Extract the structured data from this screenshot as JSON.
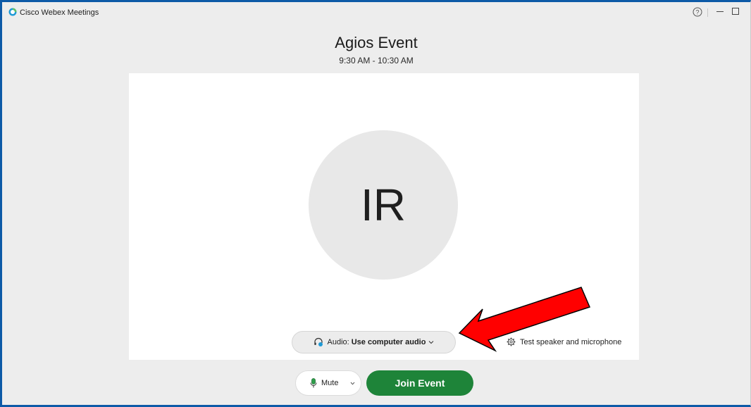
{
  "window": {
    "app_title": "Cisco Webex Meetings",
    "icons": {
      "logo": "webex-logo-icon",
      "help": "help-icon",
      "minimize": "minimize-icon",
      "maximize": "maximize-icon"
    }
  },
  "meeting": {
    "title": "Agios Event",
    "time": "9:30 AM - 10:30 AM"
  },
  "preview": {
    "avatar_initials": "IR",
    "audio": {
      "label": "Audio:",
      "value": "Use computer audio"
    },
    "test_audio_label": "Test speaker and microphone"
  },
  "controls": {
    "mute_label": "Mute",
    "join_label": "Join Event"
  },
  "colors": {
    "accent_green": "#1e8439",
    "annotation_red": "#ff0000",
    "window_border": "#0d5aa7"
  }
}
